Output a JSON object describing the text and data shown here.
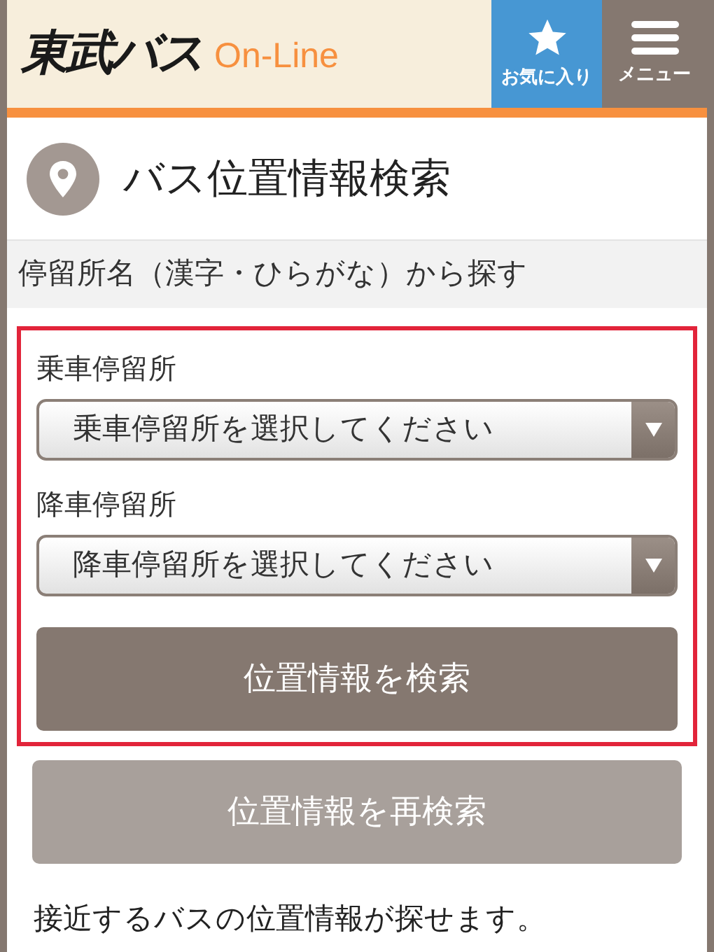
{
  "header": {
    "logo": "東武バス",
    "logo_suffix": "On-Line",
    "favorites": "お気に入り",
    "menu": "メニュー"
  },
  "page_title": "バス位置情報検索",
  "section_heading": "停留所名（漢字・ひらがな）から探す",
  "fields": [
    {
      "label": "乗車停留所",
      "placeholder": "乗車停留所を選択してください"
    },
    {
      "label": "降車停留所",
      "placeholder": "降車停留所を選択してください"
    }
  ],
  "search_button": {
    "label": "位置情報を検索",
    "disabled": false
  },
  "research_button": {
    "label": "位置情報を再検索",
    "disabled": true
  },
  "description": "接近するバスの位置情報が探せます。"
}
